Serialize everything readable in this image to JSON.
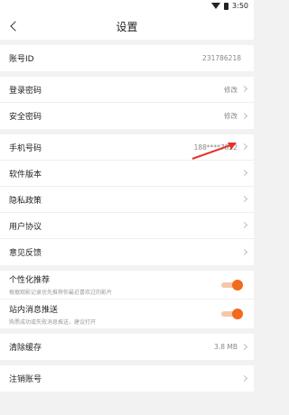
{
  "status_bar": {
    "time": "3:50"
  },
  "header": {
    "title": "设置"
  },
  "account": {
    "label": "账号ID",
    "value": "231786218"
  },
  "security": [
    {
      "label": "登录密码",
      "value": "修改"
    },
    {
      "label": "安全密码",
      "value": "修改"
    }
  ],
  "info": [
    {
      "label": "手机号码",
      "value": "188****7822"
    },
    {
      "label": "软件版本",
      "value": ""
    },
    {
      "label": "隐私政策",
      "value": ""
    },
    {
      "label": "用户协议",
      "value": ""
    },
    {
      "label": "意见反馈",
      "value": ""
    }
  ],
  "toggles": [
    {
      "label": "个性化推荐",
      "sub": "根据观影记录优先推荐你最近喜欢过的影片",
      "on": true
    },
    {
      "label": "站内消息推送",
      "sub": "购票成功或失败消息推送，建议打开",
      "on": true
    }
  ],
  "cache": {
    "label": "清除缓存",
    "value": "3.8 MB"
  },
  "logout": {
    "label": "注销账号"
  },
  "colors": {
    "accent": "#f26a1b",
    "annotation": "#e5322d"
  }
}
